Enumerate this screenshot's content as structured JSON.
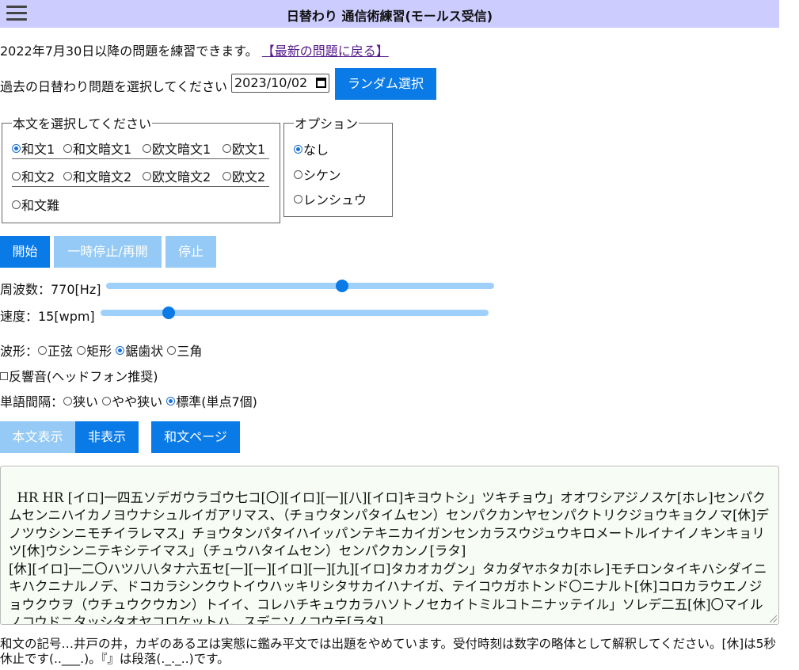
{
  "header": {
    "title": "日替わり 通信術練習(モールス受信)",
    "menu_icon": "hamburger-menu-icon"
  },
  "intro": {
    "text": "2022年7月30日以降の問題を練習できます。",
    "link": "【最新の問題に戻る】"
  },
  "date_select": {
    "label": "過去の日替わり問題を選択してください",
    "value": "2023/10/02",
    "random_button": "ランダム選択"
  },
  "text_select": {
    "legend": "本文を選択してください",
    "rows": [
      [
        "和文1",
        "和文暗文1",
        "欧文暗文1",
        "欧文1"
      ],
      [
        "和文2",
        "和文暗文2",
        "欧文暗文2",
        "欧文2"
      ],
      [
        "和文難"
      ]
    ],
    "selected": "和文1"
  },
  "options": {
    "legend": "オプション",
    "items": [
      "なし",
      "シケン",
      "レンシュウ"
    ],
    "selected": "なし"
  },
  "controls": {
    "start": "開始",
    "pause": "一時停止/再開",
    "stop": "停止"
  },
  "frequency": {
    "label": "周波数：770[Hz]",
    "value": 770
  },
  "speed": {
    "label": "速度：15[wpm]",
    "value": 15
  },
  "waveform": {
    "label": "波形：",
    "items": [
      "正弦",
      "矩形",
      "鋸歯状",
      "三角"
    ],
    "selected": "鋸歯状"
  },
  "reverb": {
    "label": "反響音(ヘッドフォン推奨)",
    "checked": false
  },
  "word_spacing": {
    "label": "単語間隔：",
    "items": [
      "狭い",
      "やや狭い",
      "標準(単点7個)"
    ],
    "selected": "標準(単点7個)"
  },
  "display": {
    "show": "本文表示",
    "hide": "非表示",
    "page": "和文ページ"
  },
  "main_text": "HR HR [イロ]一四五ソデガウラゴウ七コ[〇][イロ][一][八][イロ]キヨウトシ」ツキチョウ」オオワシアジノスケ[ホレ]センパクムセンニハイカノヨウナシュルイガアリマス、（チョウタンパタイムセン）センパクカンヤセンパクトリクジョウキョクノマ[休]デノツウシンニモチイラレマス」チョウタンパタイハイッパンテキニカイガンセンカラスウジュウキロメートルイナイノキンキョリツ[休]ウシンニテキシテイマス」（チュウハタイムセン）センパクカンノ[ラタ]\n[休][イロ]一二〇ハツ八八タナ六五セ[一][一][イロ][一][九][イロ]タカオカグン」タカダヤホタカ[ホレ]モチロンタイキハシダイニキハクニナルノデ、ドコカラシンクウトイウハッキリシタサカイハナイガ、テイコウガホトンド〇ニナルト[休]コロカラウエノジョウクウヲ（ウチュウクウカン）トイイ、コレハチキュウカラハソトノセカイトミルコトニナッテイル」ソレデ二五[休]〇マイルノコウドニタッシタオヤコロケットハ、スデニソノコウテ[ラタ]",
  "footnote": "和文の記号…井戸の井，カギのあるヱは実態に鑑み平文では出題をやめています。受付時刻は数字の略体として解釈してください。[休]は5秒休止です(..___.)。『』は段落(._._..)です。"
}
